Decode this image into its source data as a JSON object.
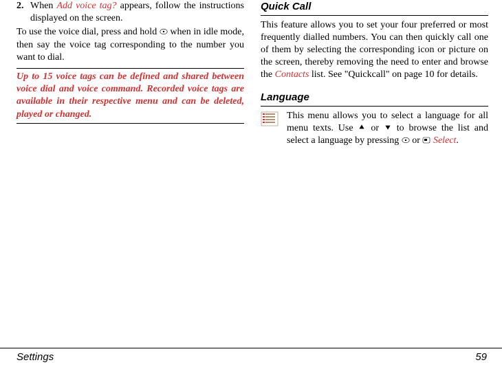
{
  "left": {
    "step_num": "2.",
    "step_text_a": "When ",
    "step_text_hl": "Add voice tag?",
    "step_text_b": " appears, follow the instructions displayed on the screen.",
    "para2_a": "To use the voice dial, press and hold ",
    "para2_b": " when in idle mode, then say the voice tag corresponding to the number you want to dial.",
    "note": "Up to 15 voice tags can be defined and shared between voice dial and voice command. Recorded voice tags are available in their respective menu and can be deleted, played or changed."
  },
  "right": {
    "quickcall_title": "Quick Call",
    "quickcall_a": "This feature allows you to set your four preferred or most frequently dialled numbers. You can then quickly call one of them by selecting the corresponding icon or picture on the screen, thereby removing the need to enter and browse the ",
    "quickcall_hl": "Contacts",
    "quickcall_b": " list. See \"Quickcall\" on page 10 for details.",
    "language_title": "Language",
    "language_a": "This menu allows you to select a language for all menu texts. Use ",
    "language_or1": " or ",
    "language_b": " to browse the list and select a language by pressing ",
    "language_or2": " or ",
    "language_hl": "Select",
    "language_end": "."
  },
  "footer": {
    "left": "Settings",
    "right": "59"
  }
}
